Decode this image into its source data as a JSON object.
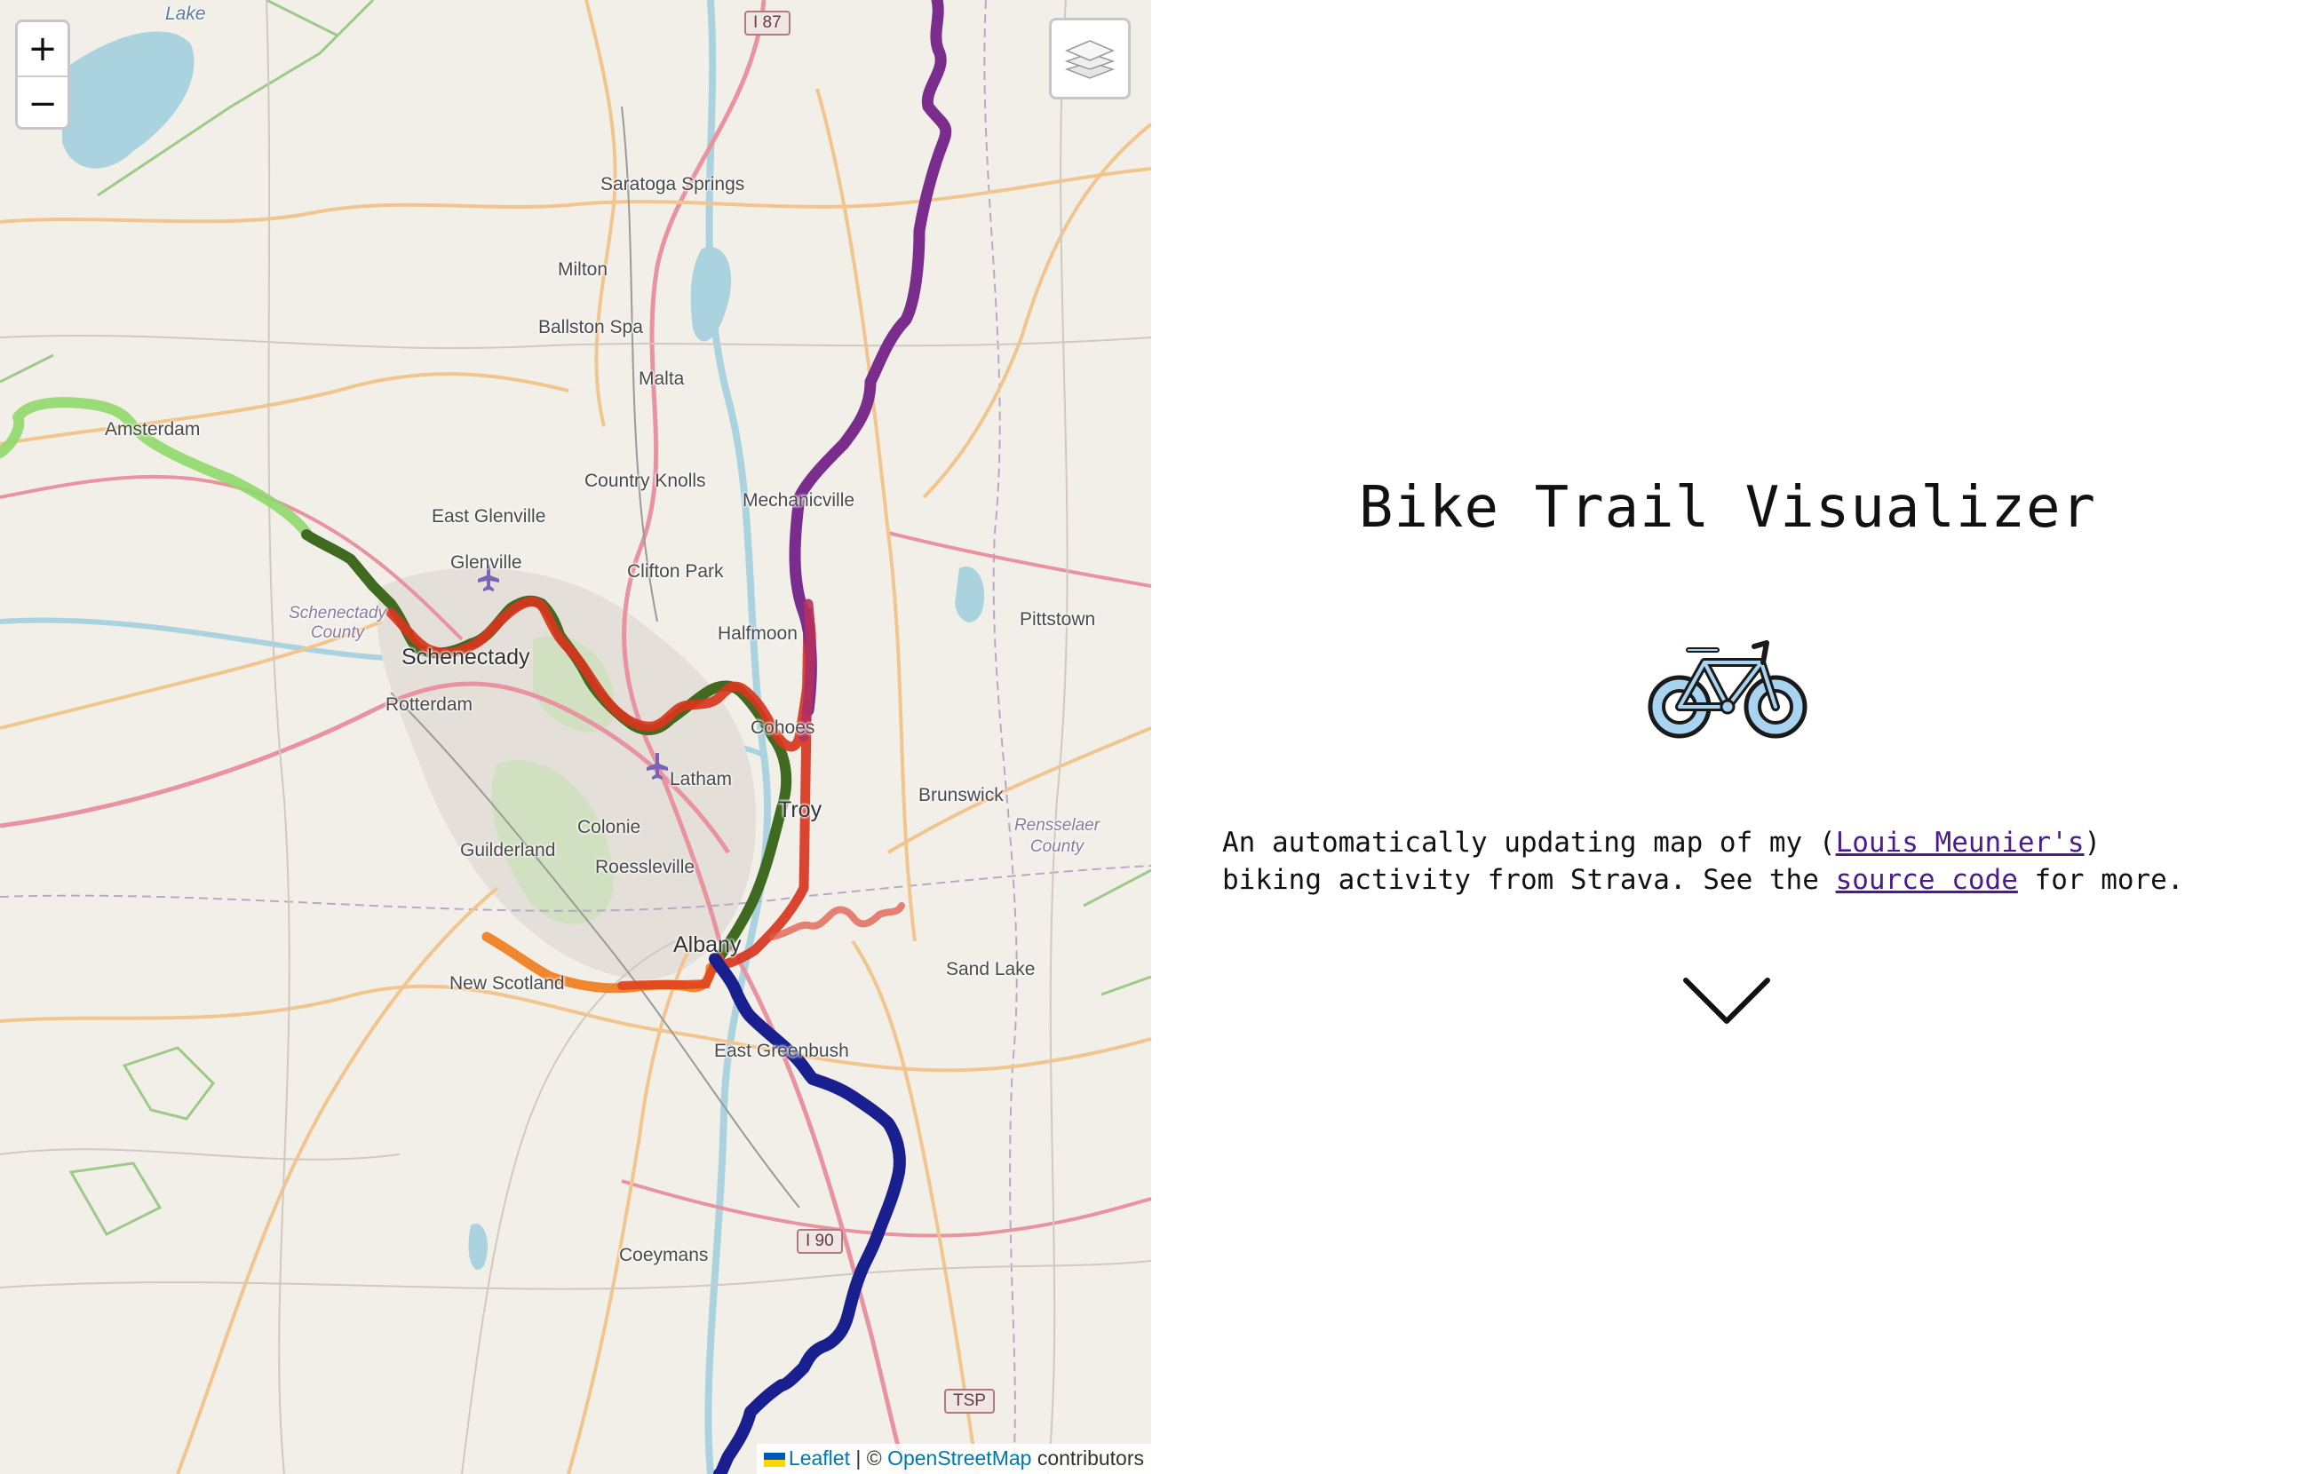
{
  "map": {
    "zoom_in_label": "+",
    "zoom_out_label": "−",
    "layers_icon": "layers-icon",
    "attribution": {
      "leaflet_label": "Leaflet",
      "separator": "| ©",
      "osm_label": "OpenStreetMap",
      "suffix": "contributors"
    },
    "places": [
      "Lake",
      "Saratoga Springs",
      "Milton",
      "Ballston Spa",
      "Malta",
      "Amsterdam",
      "Country Knolls",
      "Mechanicville",
      "East Glenville",
      "Glenville",
      "Clifton Park",
      "Halfmoon",
      "Schenectady County",
      "Schenectady",
      "Rotterdam",
      "Pittstown",
      "Cohoes",
      "Latham",
      "Troy",
      "Colonie",
      "Guilderland",
      "Roessleville",
      "Brunswick",
      "Rensselaer County",
      "Albany",
      "New Scotland",
      "Sand Lake",
      "East Greenbush",
      "Coeymans"
    ],
    "shields": [
      "I 87",
      "I 90",
      "TSP"
    ],
    "route_colors": {
      "purple": "#7b2d8e",
      "navy": "#1a1f8f",
      "dark_green": "#3f6a1f",
      "red": "#d8361e",
      "light_green": "#8fd86a",
      "orange": "#f07a1a",
      "salmon": "#e05a4a"
    }
  },
  "info": {
    "title": "Bike Trail Visualizer",
    "bike_icon": "bicycle-icon",
    "desc_intro": "An automatically updating map of my (",
    "author_link": "Louis Meunier's",
    "desc_mid": ")\nbiking activity from Strava. See the ",
    "source_link": "source code",
    "desc_end": " for more.",
    "scroll_icon": "chevron-down-icon"
  }
}
